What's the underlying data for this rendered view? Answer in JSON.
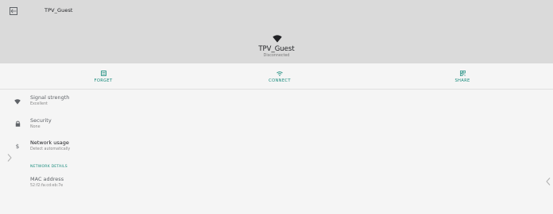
{
  "topbar": {
    "title": "TPV_Guest",
    "back_icon": "back-arrow-icon"
  },
  "header": {
    "network_name": "TPV_Guest",
    "status": "Disconnected",
    "icon": "wifi-icon"
  },
  "actions": [
    {
      "label": "FORGET",
      "icon": "forget-icon"
    },
    {
      "label": "CONNECT",
      "icon": "wifi-icon"
    },
    {
      "label": "SHARE",
      "icon": "qr-code-icon"
    }
  ],
  "details": {
    "signal": {
      "title": "Signal strength",
      "value": "Excellent",
      "icon": "wifi-icon"
    },
    "security": {
      "title": "Security",
      "value": "None",
      "icon": "lock-icon"
    },
    "usage": {
      "title": "Network usage",
      "value": "Detect automatically",
      "icon": "dollar-icon"
    }
  },
  "network_details": {
    "header": "NETWORK DETAILS",
    "mac": {
      "title": "MAC address",
      "value": "52:f2:fa:cd:eb:7e"
    }
  },
  "colors": {
    "accent": "#1a8c7e",
    "header_bg": "#dadada",
    "page_bg": "#f5f5f5"
  }
}
